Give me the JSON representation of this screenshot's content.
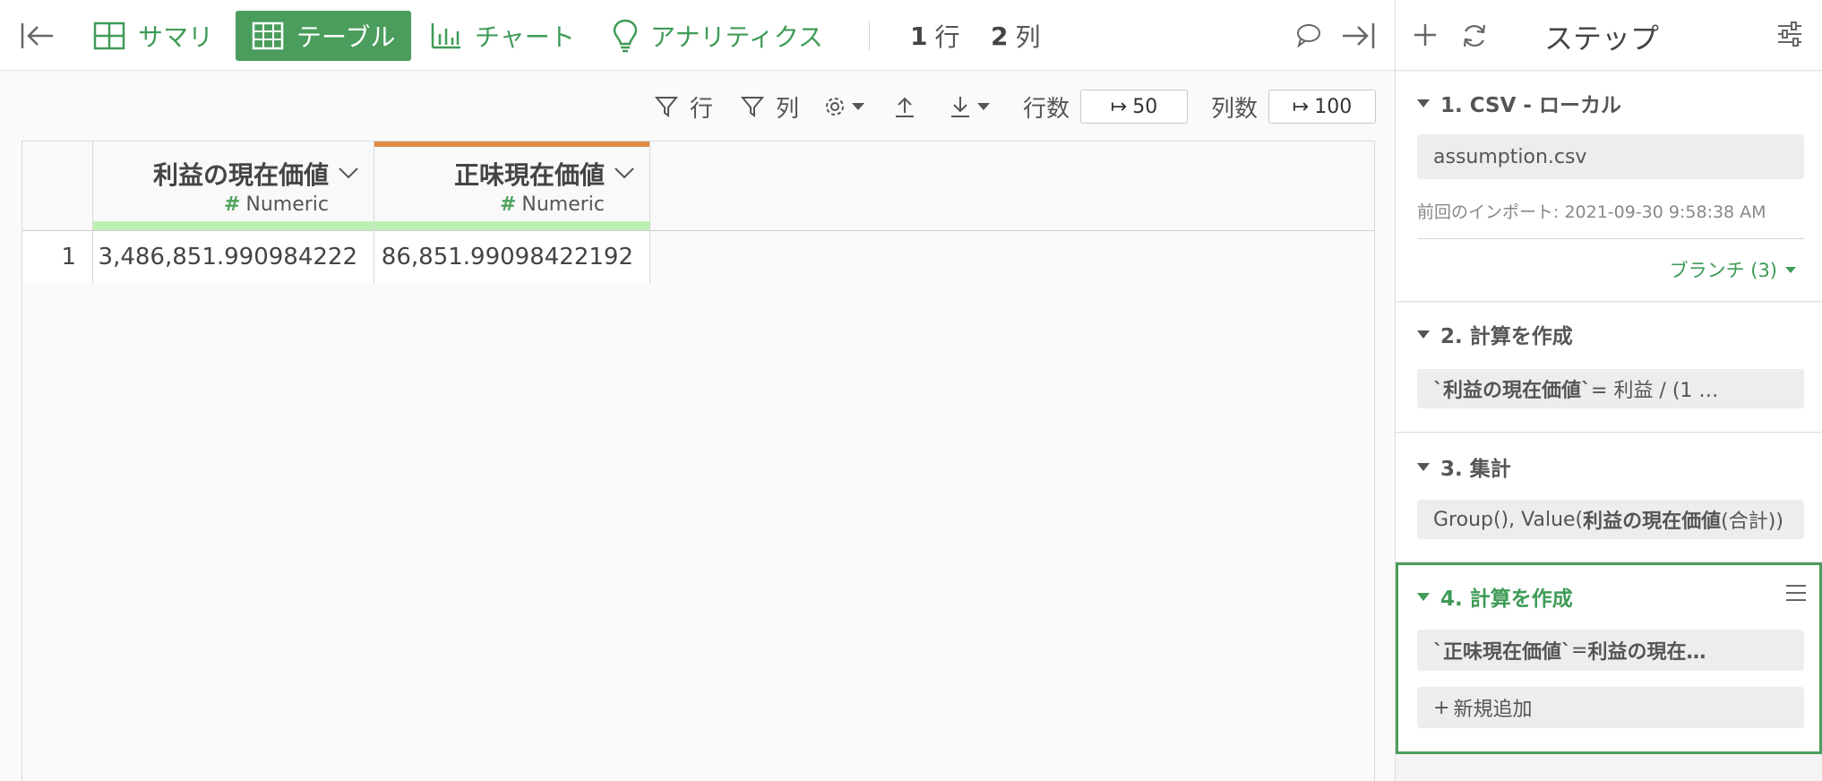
{
  "topbar": {
    "summary_label": "サマリ",
    "table_label": "テーブル",
    "chart_label": "チャート",
    "analytics_label": "アナリティクス",
    "row_count": "1",
    "row_unit": "行",
    "col_count": "2",
    "col_unit": "列"
  },
  "toolbar": {
    "filter_row_label": "行",
    "filter_col_label": "列",
    "rows_label": "行数",
    "rows_value": "50",
    "cols_label": "列数",
    "cols_value": "100"
  },
  "table": {
    "columns": [
      {
        "name": "利益の現在価値",
        "type": "Numeric"
      },
      {
        "name": "正味現在価値",
        "type": "Numeric"
      }
    ],
    "rows": [
      {
        "index": "1",
        "values": [
          "3,486,851.990984222",
          "86,851.99098422192"
        ]
      }
    ]
  },
  "steps_panel": {
    "title": "ステップ",
    "steps": [
      {
        "title": "1. CSV - ローカル",
        "file": "assumption.csv",
        "last_import": "前回のインポート: 2021-09-30 9:58:38 AM",
        "branch": "ブランチ (3)"
      },
      {
        "title": "2. 計算を作成",
        "expr_bold": "`利益の現在価値`",
        "expr_rest": " = 利益 / (1 …"
      },
      {
        "title": "3. 集計",
        "expr_pre": "Group(), Value(",
        "expr_bold": "利益の現在価値",
        "expr_rest": " (合計))"
      },
      {
        "title": "4. 計算を作成",
        "expr_bold": "`正味現在価値`",
        "expr_mid": " = ",
        "expr_bold2": "利益の現在…",
        "add_label": "新規追加"
      }
    ]
  },
  "colors": {
    "accent": "#4a9d5c",
    "active_border": "#4a9d5c",
    "orange": "#e08a44",
    "green_bar": "#bdf0b3"
  }
}
